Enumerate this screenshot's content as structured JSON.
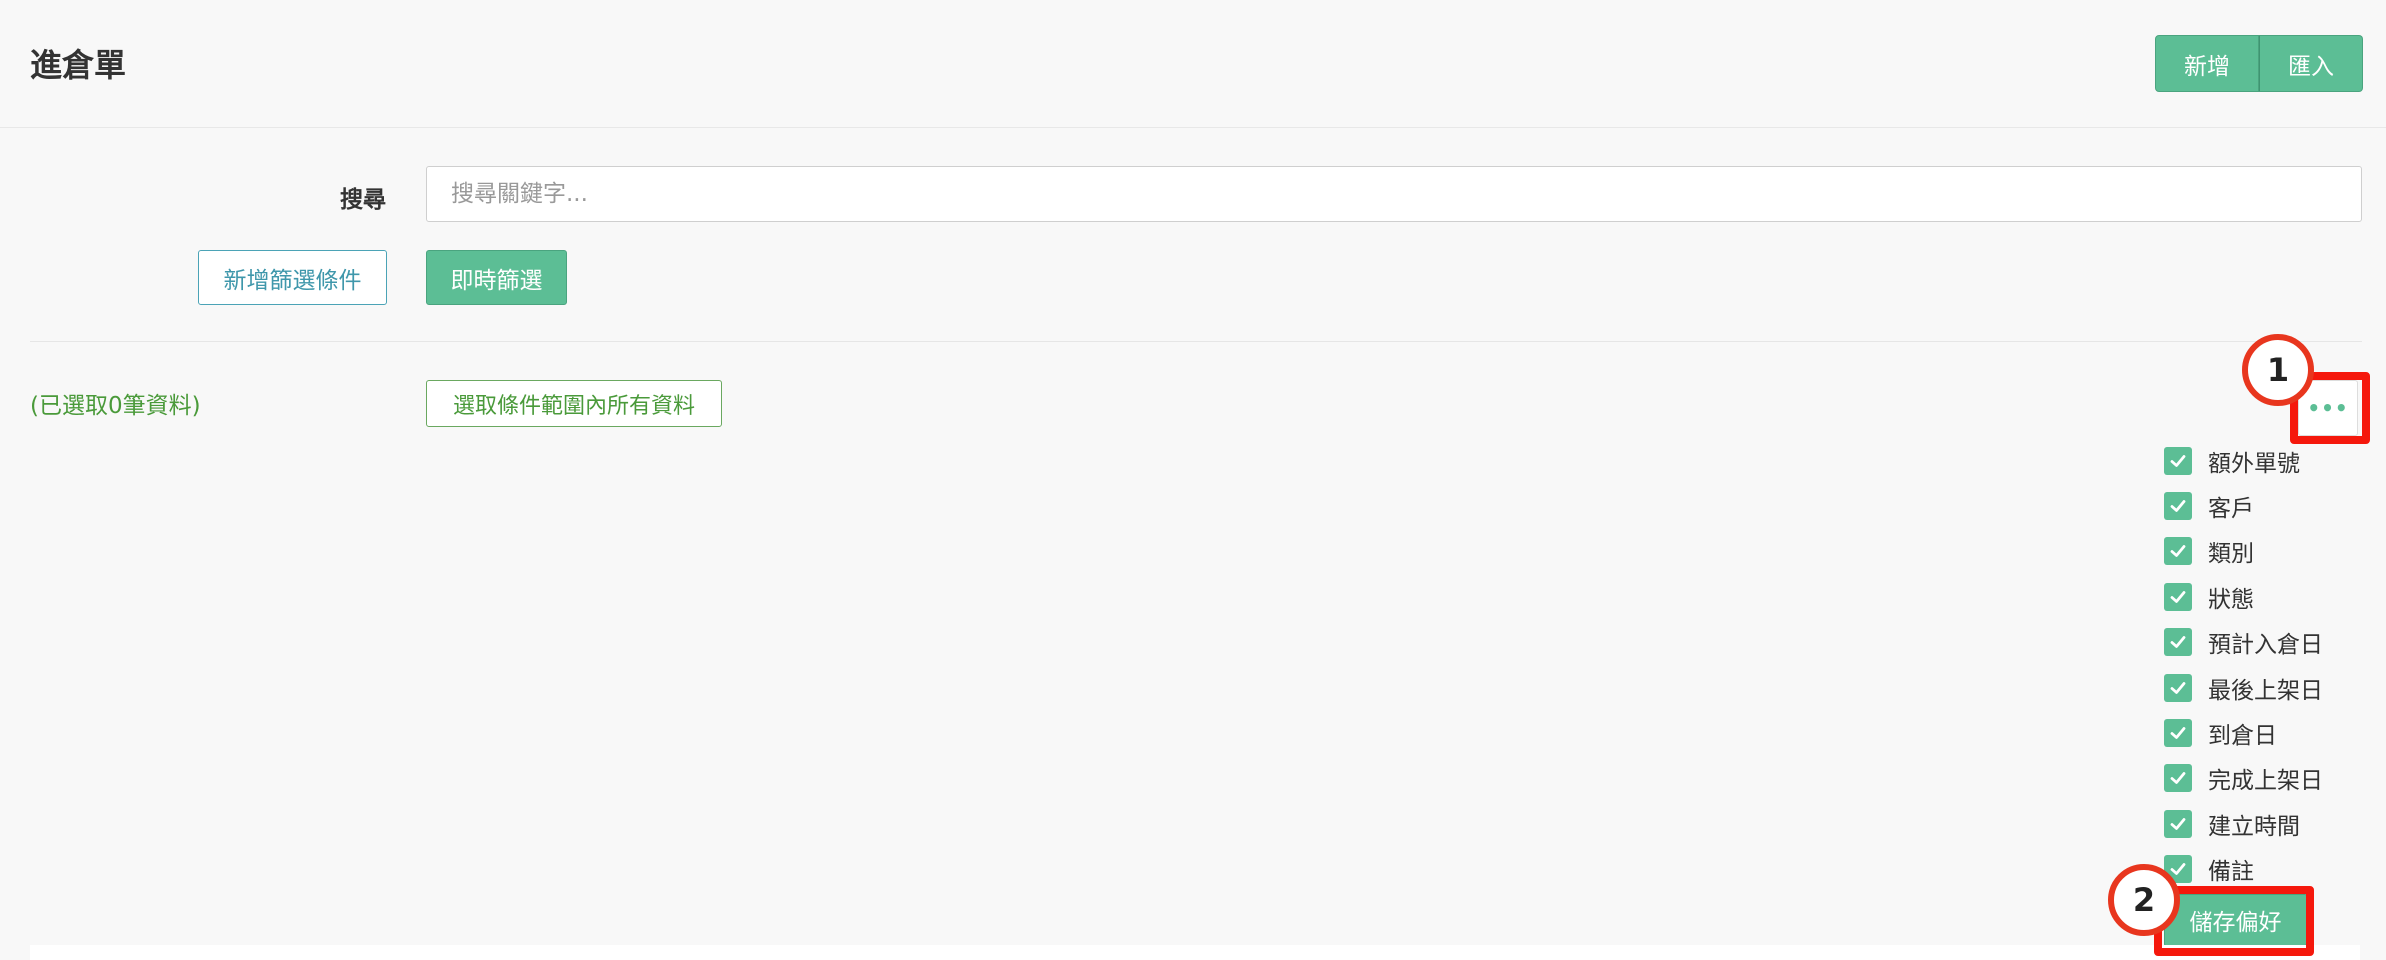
{
  "header": {
    "title": "進倉單",
    "add_label": "新增",
    "import_label": "匯入"
  },
  "search": {
    "label": "搜尋",
    "placeholder": "搜尋關鍵字..."
  },
  "filters": {
    "add_condition_label": "新增篩選條件",
    "instant_filter_label": "即時篩選"
  },
  "selection": {
    "count_text": "(已選取0筆資料)",
    "select_all_label": "選取條件範圍內所有資料"
  },
  "more_menu": {
    "icon": "more-dots-icon",
    "save_label": "儲存偏好"
  },
  "columns": [
    {
      "label": "額外單號",
      "checked": true
    },
    {
      "label": "客戶",
      "checked": true
    },
    {
      "label": "類別",
      "checked": true
    },
    {
      "label": "狀態",
      "checked": true
    },
    {
      "label": "預計入倉日",
      "checked": true
    },
    {
      "label": "最後上架日",
      "checked": true
    },
    {
      "label": "到倉日",
      "checked": true
    },
    {
      "label": "完成上架日",
      "checked": true
    },
    {
      "label": "建立時間",
      "checked": true
    },
    {
      "label": "備註",
      "checked": true
    }
  ],
  "annotations": {
    "marker_1": "1",
    "marker_2": "2",
    "highlight_color": "#f5180c"
  },
  "colors": {
    "accent": "#5cbe95",
    "teal_outline": "#4ba3b6",
    "green_text": "#4a9a3a"
  }
}
